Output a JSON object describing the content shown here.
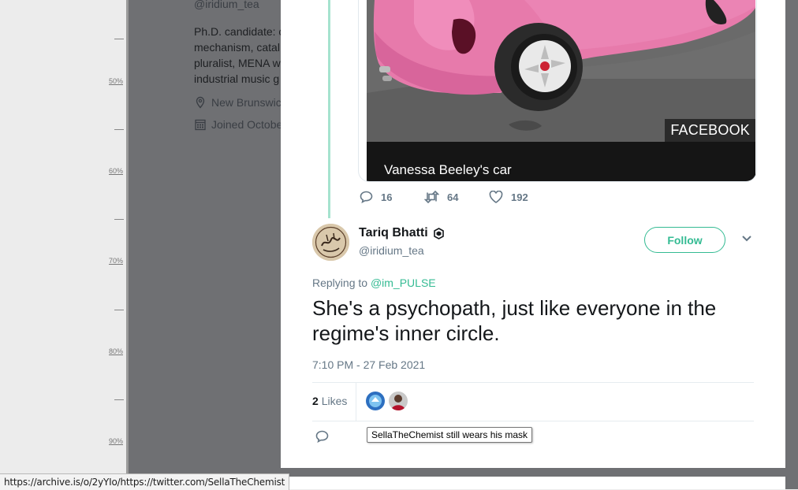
{
  "ruler": {
    "labels": [
      "50%",
      "60%",
      "70%",
      "80%",
      "90%"
    ]
  },
  "profile": {
    "handle": "@iridium_tea",
    "bio_lines": [
      "Ph.D. candidate: c",
      "mechanism, catal",
      "pluralist, MENA wa",
      "industrial music g"
    ],
    "location": "New Brunswick",
    "joined": "Joined October"
  },
  "media": {
    "badge": "FACEBOOK",
    "caption": "Vanessa Beeley's car"
  },
  "parent_actions": {
    "replies": "16",
    "retweets": "64",
    "likes": "192"
  },
  "tweet": {
    "author_name": "Tariq Bhatti",
    "author_handle": "@iridium_tea",
    "follow_label": "Follow",
    "replying_prefix": "Replying to",
    "replying_to": "@im_PULSE",
    "text": "She's a psychopath, just like everyone in the regime's inner circle.",
    "timestamp": "7:10 PM - 27 Feb 2021",
    "likes_count": "2",
    "likes_label": "Likes"
  },
  "tooltip": "SellaTheChemist still wears his mask",
  "status_url": "https://archive.is/o/2yYIo/https://twitter.com/SellaTheChemist",
  "colors": {
    "accent": "#34bb93",
    "thread_line": "#a6e3cf",
    "overlay": "#6f7073",
    "car_pink": "#e77aab"
  }
}
